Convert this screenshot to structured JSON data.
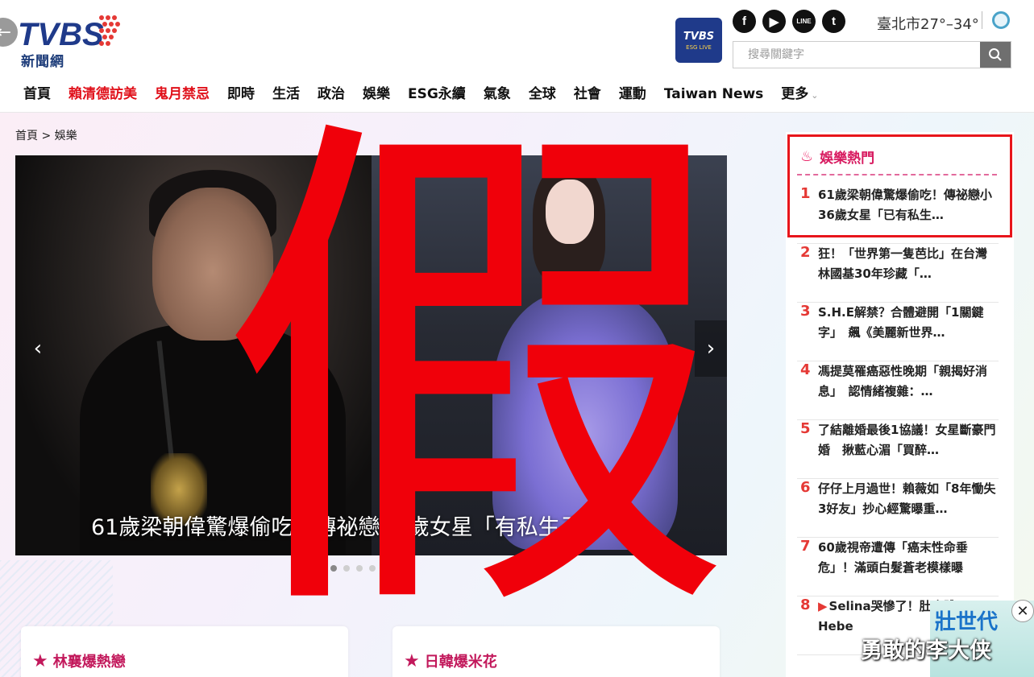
{
  "header": {
    "logo_text": "新聞網",
    "live_badge": {
      "brand": "TVBS",
      "sub": "ESG LIVE"
    },
    "social_icons": [
      "facebook-icon",
      "youtube-icon",
      "line-icon",
      "twitter-icon"
    ],
    "weather": {
      "city": "臺北市",
      "temp": "27°–34°"
    },
    "search": {
      "placeholder": "搜尋關鍵字"
    }
  },
  "nav": {
    "items": [
      {
        "label": "首頁",
        "hot": false,
        "active": false
      },
      {
        "label": "賴清德訪美",
        "hot": true,
        "active": false
      },
      {
        "label": "鬼月禁忌",
        "hot": true,
        "active": false
      },
      {
        "label": "即時",
        "hot": false,
        "active": false
      },
      {
        "label": "生活",
        "hot": false,
        "active": false
      },
      {
        "label": "政治",
        "hot": false,
        "active": false
      },
      {
        "label": "娛樂",
        "hot": false,
        "active": true
      },
      {
        "label": "ESG永續",
        "hot": false,
        "active": false
      },
      {
        "label": "氣象",
        "hot": false,
        "active": false
      },
      {
        "label": "全球",
        "hot": false,
        "active": false
      },
      {
        "label": "社會",
        "hot": false,
        "active": false
      },
      {
        "label": "運動",
        "hot": false,
        "active": false
      },
      {
        "label": "Taiwan News",
        "hot": false,
        "active": false
      },
      {
        "label": "更多",
        "hot": false,
        "active": false
      }
    ]
  },
  "breadcrumb": "首頁 > 娛樂",
  "slider": {
    "caption": "61歲梁朝偉驚爆偷吃！傳祕戀36歲女星「有私生子」",
    "dots": 5,
    "active_dot": 0
  },
  "cards": [
    {
      "title": "林襄爆熱戀"
    },
    {
      "title": "日韓爆米花"
    }
  ],
  "hot_list": {
    "title": "娛樂熱門",
    "items": [
      {
        "num": "1",
        "text": "61歲梁朝偉驚爆偷吃！傳祕戀小36歲女星「已有私生…",
        "video": false
      },
      {
        "num": "2",
        "text": "狂！「世界第一隻芭比」在台灣　林國基30年珍藏「…",
        "video": false
      },
      {
        "num": "3",
        "text": "S.H.E解禁？合體避開「1關鍵字」　飆《美麗新世界…",
        "video": false
      },
      {
        "num": "4",
        "text": "馮提莫罹癌惡性晚期「親揭好消息」　認情緒複雜：…",
        "video": false
      },
      {
        "num": "5",
        "text": "了結離婚最後1協議！女星斷豪門婚　揪藍心湄「買醉…",
        "video": false
      },
      {
        "num": "6",
        "text": "仔仔上月過世！賴薇如「8年慟失3好友」抄心經驚曝重…",
        "video": false
      },
      {
        "num": "7",
        "text": "60歲視帝遭傳「癌末性命垂危」！滿頭白髮蒼老模樣曝",
        "video": false
      },
      {
        "num": "8",
        "text": "Selina哭慘了！肚合體Ella、Hebe",
        "video": true
      }
    ]
  },
  "ad": {
    "text": "壯世代"
  },
  "overlay": {
    "fake_mark": "假",
    "watermark": "勇敢的李大侠"
  },
  "colors": {
    "accent_red": "#e0101a",
    "hot_pink": "#d81b60",
    "brand_blue": "#1f3a8a"
  }
}
